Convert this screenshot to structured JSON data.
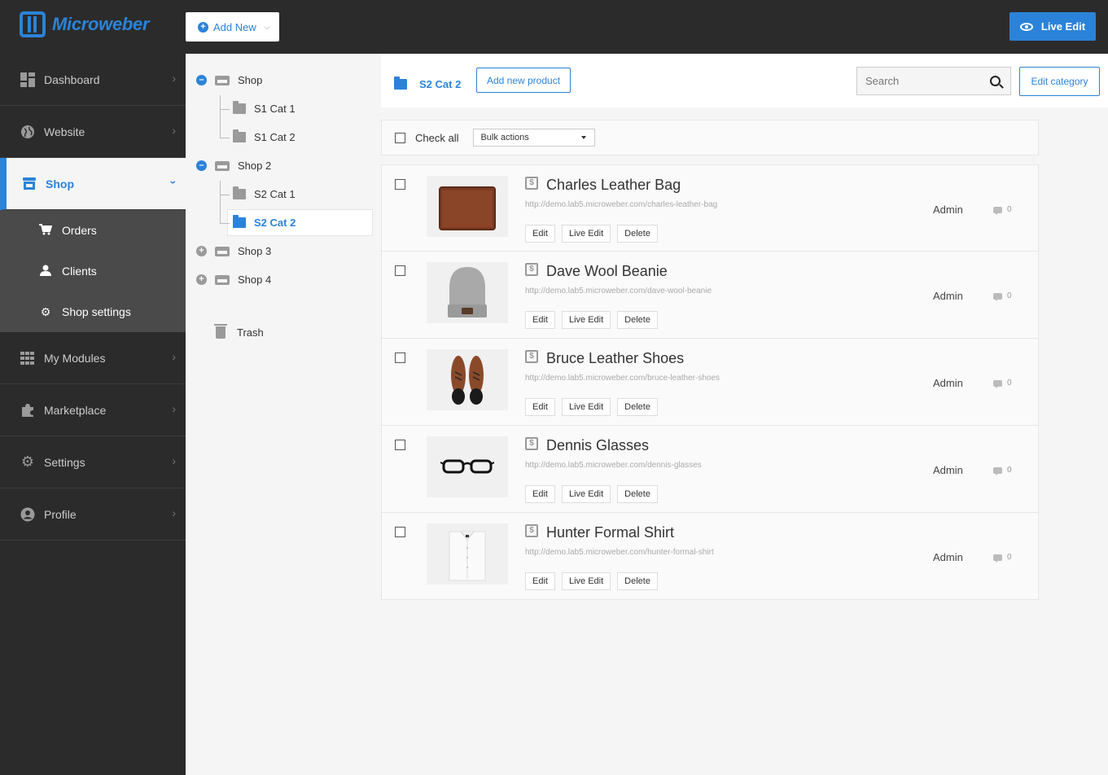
{
  "brand": {
    "name": "Microweber",
    "accent": "#2b83d9",
    "topbar_bg": "#2b2b2b"
  },
  "header": {
    "add_new_label": "Add New",
    "live_edit_label": "Live Edit"
  },
  "sidebar": {
    "items": [
      {
        "label": "Dashboard",
        "icon": "dashboard-icon"
      },
      {
        "label": "Website",
        "icon": "globe-icon"
      },
      {
        "label": "Shop",
        "icon": "shop-icon",
        "active": true
      },
      {
        "label": "My Modules",
        "icon": "modules-icon"
      },
      {
        "label": "Marketplace",
        "icon": "puzzle-icon"
      },
      {
        "label": "Settings",
        "icon": "gear-icon"
      },
      {
        "label": "Profile",
        "icon": "user-circle-icon"
      }
    ],
    "shop_submenu": [
      {
        "label": "Orders",
        "icon": "cart-icon"
      },
      {
        "label": "Clients",
        "icon": "user-icon"
      },
      {
        "label": "Shop settings",
        "icon": "gear-icon"
      }
    ]
  },
  "tree": {
    "shop": "Shop",
    "s1_cat1": "S1 Cat 1",
    "s1_cat2": "S1 Cat 2",
    "shop2": "Shop 2",
    "s2_cat1": "S2 Cat 1",
    "s2_cat2": "S2 Cat 2",
    "shop3": "Shop 3",
    "shop4": "Shop 4",
    "trash": "Trash"
  },
  "main": {
    "category_title": "S2 Cat 2",
    "add_product_label": "Add new product",
    "search_placeholder": "Search",
    "edit_category_label": "Edit category",
    "check_all_label": "Check all",
    "bulk_actions_label": "Bulk actions"
  },
  "products": [
    {
      "title": "Charles Leather Bag",
      "url": "http://demo.lab5.microweber.com/charles-leather-bag",
      "author": "Admin",
      "comments": "0",
      "thumb": "wallet"
    },
    {
      "title": "Dave Wool Beanie",
      "url": "http://demo.lab5.microweber.com/dave-wool-beanie",
      "author": "Admin",
      "comments": "0",
      "thumb": "beanie"
    },
    {
      "title": "Bruce Leather Shoes",
      "url": "http://demo.lab5.microweber.com/bruce-leather-shoes",
      "author": "Admin",
      "comments": "0",
      "thumb": "shoes"
    },
    {
      "title": "Dennis Glasses",
      "url": "http://demo.lab5.microweber.com/dennis-glasses",
      "author": "Admin",
      "comments": "0",
      "thumb": "glasses"
    },
    {
      "title": "Hunter Formal Shirt",
      "url": "http://demo.lab5.microweber.com/hunter-formal-shirt",
      "author": "Admin",
      "comments": "0",
      "thumb": "shirt"
    }
  ],
  "row_actions": {
    "edit": "Edit",
    "live_edit": "Live Edit",
    "delete": "Delete"
  }
}
